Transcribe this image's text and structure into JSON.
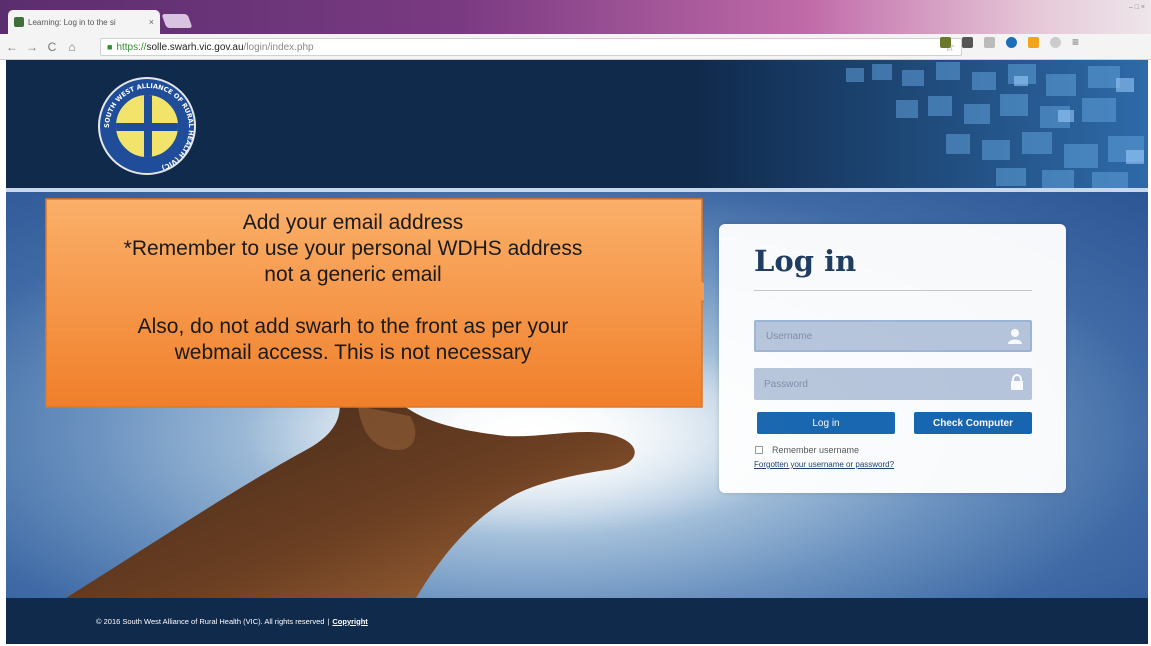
{
  "browser": {
    "tab_title": "Learning: Log in to the si",
    "tab_close": "×",
    "url_https": "https://",
    "url_host": "solle.swarh.vic.gov.au",
    "url_path": "/login/index.php",
    "window_controls": "– □ ×",
    "icons": {
      "back": "back-arrow-icon",
      "forward": "forward-arrow-icon",
      "reload": "reload-icon",
      "home": "home-icon",
      "lock": "lock-icon",
      "star": "star-icon",
      "menu": "menu-icon"
    },
    "back_glyph": "←",
    "forward_glyph": "→",
    "reload_glyph": "C",
    "home_glyph": "⌂",
    "lock_glyph": "■",
    "star_glyph": "☆",
    "menu_glyph": "≡"
  },
  "header": {
    "logo_ring_text": "SOUTH WEST ALLIANCE OF RURAL HEALTH (VIC)"
  },
  "callout": {
    "lines": [
      "Add your email address",
      "*Remember to use your personal WDHS address",
      "not a generic email",
      "Also, do not add swarh to the front as per your",
      "webmail access. This is not necessary"
    ]
  },
  "login": {
    "title": "Log in",
    "username_placeholder": "Username",
    "password_placeholder": "Password",
    "login_button": "Log in",
    "check_button": "Check Computer",
    "remember_label": "Remember username",
    "forgot_link": "Forgotten your username or password?"
  },
  "footer": {
    "copyright": "© 2016 South West Alliance of Rural Health (VIC). All rights reserved",
    "separator": "|",
    "link": "Copyright"
  },
  "colors": {
    "header_bg": "#102a4c",
    "button_bg": "#1564b0",
    "callout_orange": "#f5923a"
  }
}
